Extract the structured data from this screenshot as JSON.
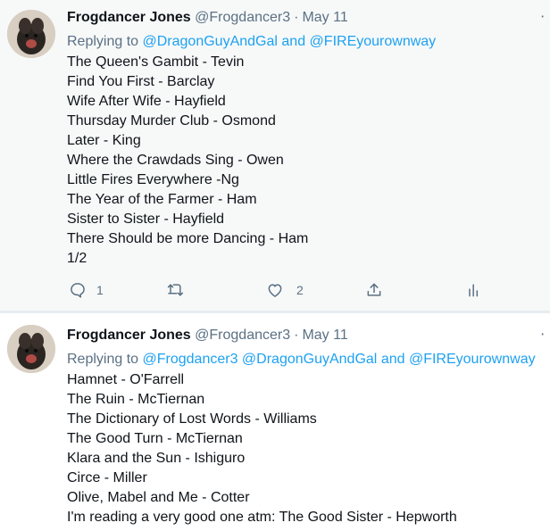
{
  "tweets": [
    {
      "author_name": "Frogdancer Jones",
      "handle": "@Frogdancer3",
      "separator": "·",
      "date": "May 11",
      "replying_prefix": "Replying to",
      "mentions": [
        "@DragonGuyAndGal",
        "@FIREyourownway"
      ],
      "mention_joiner": "and",
      "lines": [
        "The Queen's Gambit - Tevin",
        "Find You First - Barclay",
        "Wife After Wife - Hayfield",
        "Thursday Murder Club - Osmond",
        "Later - King",
        "Where the Crawdads Sing - Owen",
        "Little Fires Everywhere -Ng",
        "The Year of the Farmer - Ham",
        "Sister to Sister - Hayfield",
        "There Should be more Dancing - Ham",
        "1/2"
      ],
      "reply_count": "1",
      "like_count": "2",
      "icons": [
        "reply-icon",
        "retweet-icon",
        "like-icon",
        "share-icon",
        "analytics-icon"
      ]
    },
    {
      "author_name": "Frogdancer Jones",
      "handle": "@Frogdancer3",
      "separator": "·",
      "date": "May 11",
      "replying_prefix": "Replying to",
      "mentions": [
        "@Frogdancer3",
        "@DragonGuyAndGal",
        "@FIREyourownway"
      ],
      "mention_joiner": "and",
      "lines": [
        "Hamnet - O'Farrell",
        "The Ruin - McTiernan",
        "The Dictionary of Lost Words - Williams",
        "The Good Turn - McTiernan",
        "Klara and the Sun - Ishiguro",
        "Circe - Miller",
        "Olive, Mabel and Me - Cotter",
        "I'm reading a very good one atm: The Good Sister - Hepworth"
      ]
    }
  ],
  "colors": {
    "link": "#1da1f2",
    "muted": "#5b7083",
    "text": "#0f1419",
    "hover_background": "#f7f9f9"
  }
}
